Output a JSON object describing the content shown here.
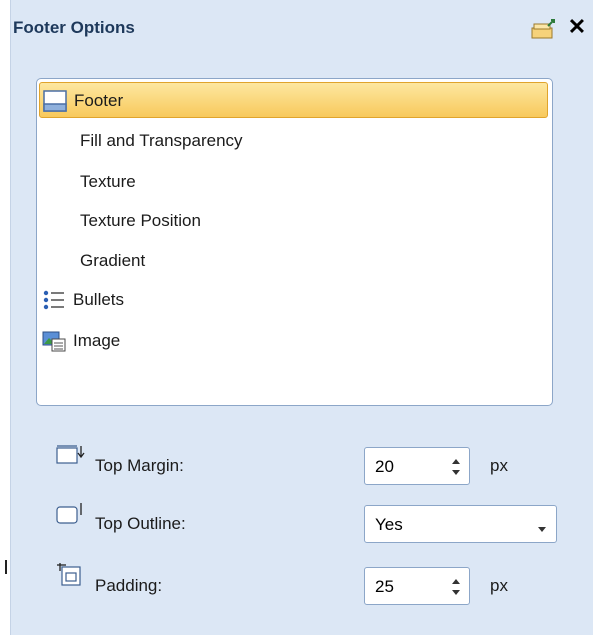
{
  "panel": {
    "title": "Footer Options",
    "pin_icon": "pin-icon",
    "close_icon": "close-icon",
    "close_glyph": "✕"
  },
  "list": {
    "items": [
      {
        "label": "Footer",
        "icon": "footer-icon",
        "selected": true
      },
      {
        "label": "Fill and Transparency",
        "icon": null,
        "selected": false
      },
      {
        "label": "Texture",
        "icon": null,
        "selected": false
      },
      {
        "label": "Texture Position",
        "icon": null,
        "selected": false
      },
      {
        "label": "Gradient",
        "icon": null,
        "selected": false
      },
      {
        "label": "Bullets",
        "icon": "bullets-icon",
        "selected": false
      },
      {
        "label": "Image",
        "icon": "image-icon",
        "selected": false
      }
    ]
  },
  "form": {
    "top_margin": {
      "label": "Top Margin:",
      "value": "20",
      "unit": "px",
      "icon": "top-margin-icon"
    },
    "top_outline": {
      "label": "Top Outline:",
      "value": "Yes",
      "icon": "top-outline-icon"
    },
    "padding": {
      "label": "Padding:",
      "value": "25",
      "unit": "px",
      "icon": "padding-icon"
    }
  },
  "colors": {
    "panel_bg": "#dce7f5",
    "title_text": "#1e395b",
    "selection_bg": "#f8c95c",
    "border": "#8ca6c8"
  }
}
